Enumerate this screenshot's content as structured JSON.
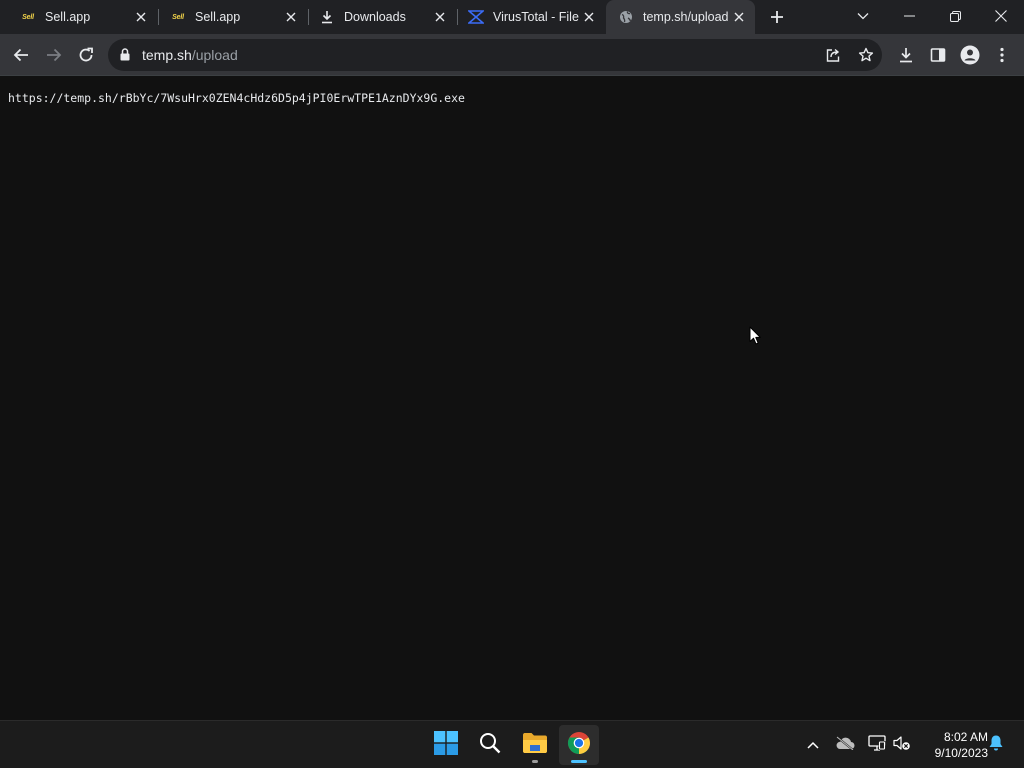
{
  "browser": {
    "tabs": [
      {
        "title": "Sell.app",
        "favicon": "sell-app-logo",
        "logo_text": "Sell",
        "active": false
      },
      {
        "title": "Sell.app",
        "favicon": "sell-app-logo",
        "logo_text": "Sell",
        "active": false
      },
      {
        "title": "Downloads",
        "favicon": "download-icon",
        "active": false
      },
      {
        "title": "VirusTotal - File",
        "favicon": "virustotal-logo",
        "active": false
      },
      {
        "title": "temp.sh/upload",
        "favicon": "globe-icon",
        "active": true
      }
    ],
    "address_bar": {
      "host": "temp.sh",
      "path": "/upload"
    }
  },
  "page": {
    "text": "https://temp.sh/rBbYc/7WsuHrx0ZEN4cHdz6D5p4jPI0ErwTPE1AznDYx9G.exe"
  },
  "taskbar": {
    "apps": [
      "start-icon",
      "search-icon",
      "file-explorer-icon",
      "chrome-icon"
    ],
    "clock": {
      "time": "8:02 AM",
      "date": "9/10/2023"
    }
  },
  "colors": {
    "page_background": "#111111",
    "tab_strip": "#202124",
    "active_tab": "#35363a",
    "accent": "#4cc2ff"
  }
}
